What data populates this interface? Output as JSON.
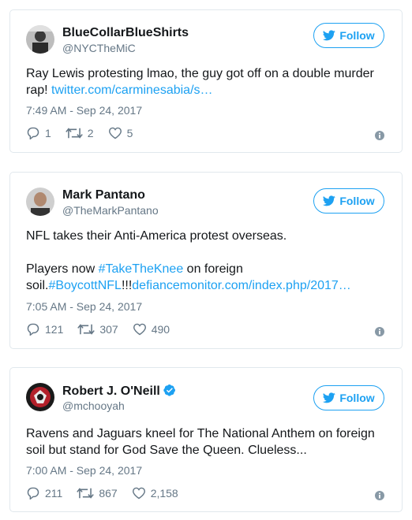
{
  "tweets": [
    {
      "name": "BlueCollarBlueShirts",
      "handle": "@NYCTheMiC",
      "follow_label": "Follow",
      "text_line1_plain": "Ray Lewis protesting lmao, the guy got off on a double murder",
      "text_line2_plain": "rap! ",
      "text_line2_link": "twitter.com/carminesabia/s…",
      "time": "7:49 AM - Sep 24, 2017",
      "replies": "1",
      "retweets": "2",
      "likes": "5"
    },
    {
      "name": "Mark Pantano",
      "handle": "@TheMarkPantano",
      "follow_label": "Follow",
      "text_line1_plain": "NFL takes their Anti-America protest overseas.",
      "text_line3_plain_a": "Players now ",
      "text_line3_hashtag": "#TakeTheKnee",
      "text_line3_plain_b": " on foreign",
      "text_line4_plain_a": "soil.",
      "text_line4_hashtag": "#BoycottNFL",
      "text_line4_plain_b": "!!!",
      "text_line4_link": "defiancemonitor.com/index.php/2017…",
      "time": "7:05 AM - Sep 24, 2017",
      "replies": "121",
      "retweets": "307",
      "likes": "490"
    },
    {
      "name": "Robert J. O'Neill",
      "handle": "@mchooyah",
      "follow_label": "Follow",
      "text_line1_plain": "Ravens and Jaguars kneel for The National Anthem on foreign",
      "text_line2_plain": "soil but stand for God Save the Queen. Clueless...",
      "time": "7:00 AM - Sep 24, 2017",
      "replies": "211",
      "retweets": "867",
      "likes": "2,158"
    }
  ],
  "colors": {
    "link": "#1da1f2",
    "muted": "#657786",
    "border": "#e1e8ed"
  }
}
